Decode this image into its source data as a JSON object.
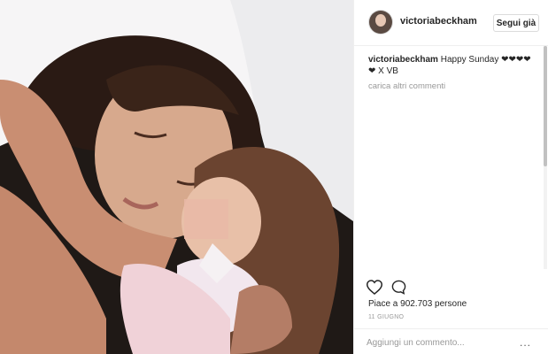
{
  "post": {
    "username": "victoriabeckham",
    "follow_label": "Segui già",
    "caption_user": "victoriabeckham",
    "caption_text": "Happy Sunday ❤❤❤❤❤ X VB",
    "load_more": "carica altri commenti",
    "likes": "Piace a 902.703 persone",
    "date": "11 GIUGNO",
    "comment_placeholder": "Aggiungi un commento...",
    "more_options": "..."
  },
  "icons": {
    "like": "heart-outline-icon",
    "comment": "speech-bubble-icon",
    "avatar": "profile-avatar"
  },
  "colors": {
    "text": "#262626",
    "muted": "#999999",
    "border": "#efefef"
  }
}
